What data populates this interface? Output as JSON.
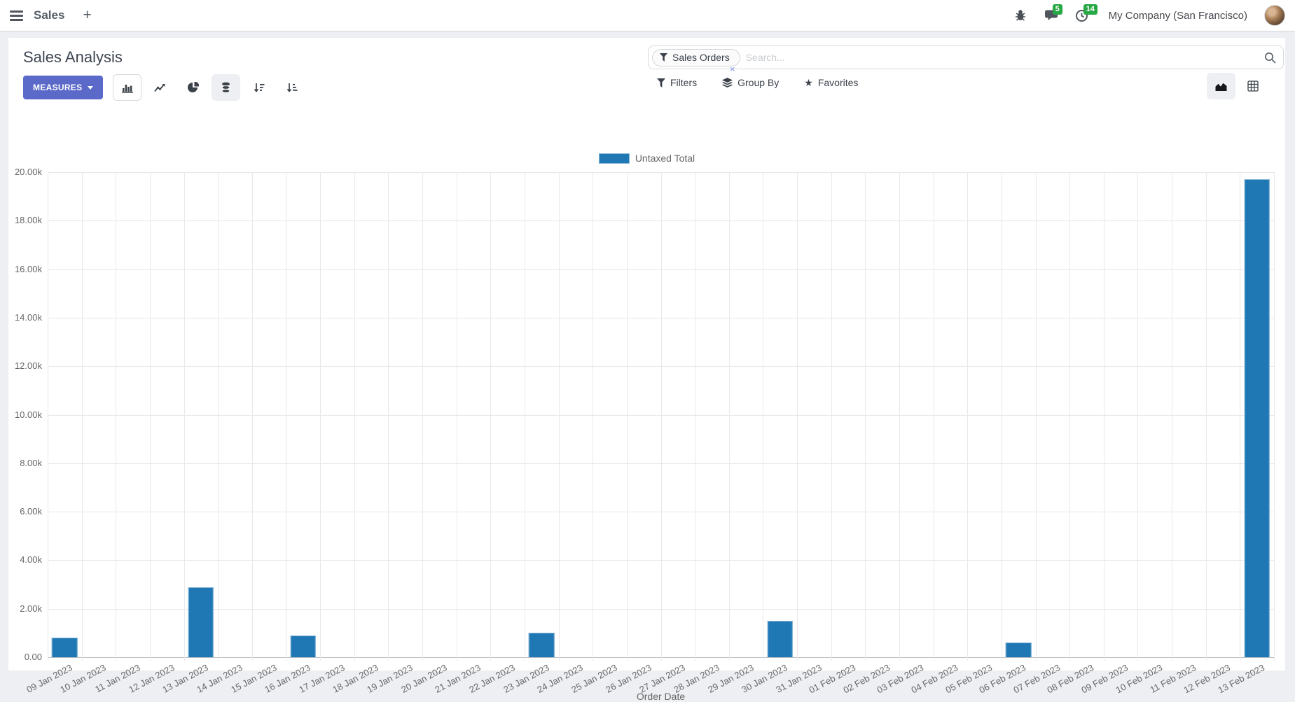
{
  "topbar": {
    "app_name": "Sales",
    "plus": "+",
    "message_badge": "5",
    "activity_badge": "14",
    "company": "My Company (San Francisco)"
  },
  "control_panel": {
    "title": "Sales Analysis",
    "measures_label": "MEASURES",
    "search": {
      "facet_label": "Sales Orders",
      "facet_remove": "×",
      "placeholder": "Search..."
    },
    "filters_label": "Filters",
    "group_by_label": "Group By",
    "favorites_label": "Favorites",
    "favorites_star": "★"
  },
  "chart_data": {
    "type": "bar",
    "title": "",
    "legend": [
      "Untaxed Total"
    ],
    "legend_position": "top",
    "grid": true,
    "xlabel": "Order Date",
    "ylabel": "",
    "ylim": [
      0,
      20000
    ],
    "y_ticks": [
      "20.00k",
      "18.00k",
      "16.00k",
      "14.00k",
      "12.00k",
      "10.00k",
      "8.00k",
      "6.00k",
      "4.00k",
      "2.00k",
      "0.00"
    ],
    "categories": [
      "09 Jan 2023",
      "10 Jan 2023",
      "11 Jan 2023",
      "12 Jan 2023",
      "13 Jan 2023",
      "14 Jan 2023",
      "15 Jan 2023",
      "16 Jan 2023",
      "17 Jan 2023",
      "18 Jan 2023",
      "19 Jan 2023",
      "20 Jan 2023",
      "21 Jan 2023",
      "22 Jan 2023",
      "23 Jan 2023",
      "24 Jan 2023",
      "25 Jan 2023",
      "26 Jan 2023",
      "27 Jan 2023",
      "28 Jan 2023",
      "29 Jan 2023",
      "30 Jan 2023",
      "31 Jan 2023",
      "01 Feb 2023",
      "02 Feb 2023",
      "03 Feb 2023",
      "04 Feb 2023",
      "05 Feb 2023",
      "06 Feb 2023",
      "07 Feb 2023",
      "08 Feb 2023",
      "09 Feb 2023",
      "10 Feb 2023",
      "11 Feb 2023",
      "12 Feb 2023",
      "13 Feb 2023"
    ],
    "series": [
      {
        "name": "Untaxed Total",
        "color": "#1f77b4",
        "values": [
          800,
          0,
          0,
          0,
          2900,
          0,
          0,
          900,
          0,
          0,
          0,
          0,
          0,
          0,
          1000,
          0,
          0,
          0,
          0,
          0,
          0,
          1500,
          0,
          0,
          0,
          0,
          0,
          0,
          600,
          0,
          0,
          0,
          0,
          0,
          0,
          19700
        ]
      }
    ]
  },
  "colors": {
    "bar": "#1f77b4",
    "measures_button": "#5b6ac9",
    "badge_green": "#28a745",
    "gridline": "#e6e6e6",
    "axis_text": "#666666"
  }
}
